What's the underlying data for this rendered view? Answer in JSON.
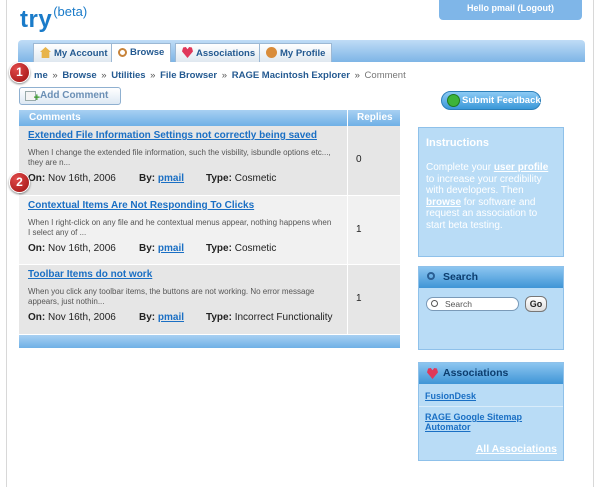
{
  "logo": {
    "main": "try",
    "sup": "(beta)"
  },
  "header": {
    "hello": "Hello pmail (Logout)"
  },
  "tabs": [
    {
      "label": "My Account",
      "icon": "home-icon"
    },
    {
      "label": "Browse",
      "icon": "magnifier-icon"
    },
    {
      "label": "Associations",
      "icon": "heart-icon"
    },
    {
      "label": "My Profile",
      "icon": "profile-icon"
    }
  ],
  "breadcrumb": {
    "items": [
      "me",
      "Browse",
      "Utilities",
      "File Browser",
      "RAGE Macintosh Explorer"
    ],
    "current": "Comment",
    "sep": "»"
  },
  "badges": [
    "1",
    "2"
  ],
  "actions": {
    "add_comment": "Add Comment",
    "submit_feedback": "Submit Feedback"
  },
  "table": {
    "headers": [
      "Comments",
      "Replies"
    ],
    "on_label": "On:",
    "by_label": "By:",
    "type_label": "Type:",
    "rows": [
      {
        "title": "Extended File Information Settings not correctly being saved",
        "desc": "When I change the extended file information, such the visbility, isbundle options etc..., they are n...",
        "date": "Nov 16th, 2006",
        "by": "pmail",
        "type": "Cosmetic",
        "replies": "0"
      },
      {
        "title": "Contextual Items Are Not Responding To Clicks",
        "desc": "When I right-click on any file and he contextual menus appear, nothing happens when I select any of ...",
        "date": "Nov 16th, 2006",
        "by": "pmail",
        "type": "Cosmetic",
        "replies": "1"
      },
      {
        "title": "Toolbar Items do not work",
        "desc": "When you click any toolbar items, the buttons are not working. No error message appears, just nothin...",
        "date": "Nov 16th, 2006",
        "by": "pmail",
        "type": "Incorrect Functionality",
        "replies": "1"
      }
    ]
  },
  "instructions": {
    "heading": "Instructions",
    "t1": "Complete your ",
    "link1": "user profile",
    "t2": " to increase your credibility with developers. Then ",
    "link2": "browse",
    "t3": " for software and request an association to start beta testing."
  },
  "search": {
    "heading": "Search",
    "placeholder": "Search",
    "go": "Go"
  },
  "associations": {
    "heading": "Associations",
    "items": [
      "FusionDesk",
      "RAGE Google Sitemap Automator"
    ],
    "all": "All Associations"
  },
  "colors": {
    "accent": "#1a7bc9",
    "panel": "#b9dcf6",
    "badge": "#b81e1e"
  }
}
